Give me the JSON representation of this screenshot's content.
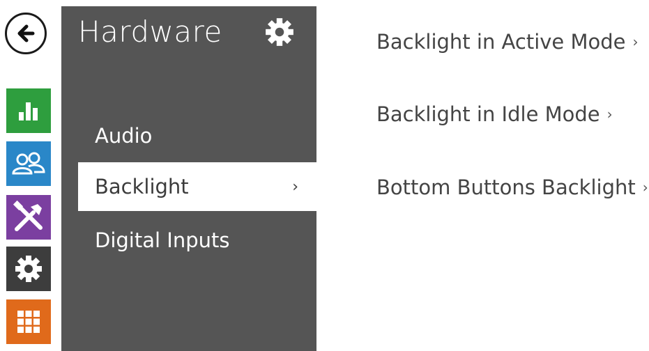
{
  "nav": {
    "back_icon": "arrow-left-icon",
    "tiles": [
      {
        "name": "status",
        "icon": "bar-chart-icon",
        "color": "#2e9e3e"
      },
      {
        "name": "directory",
        "icon": "users-icon",
        "color": "#2a87c8"
      },
      {
        "name": "services",
        "icon": "tools-icon",
        "color": "#7b3fa0"
      },
      {
        "name": "hardware",
        "icon": "gear-icon",
        "color": "#3d3d3d"
      },
      {
        "name": "system",
        "icon": "grid-icon",
        "color": "#e06a1b"
      }
    ]
  },
  "panel": {
    "title": "Hardware",
    "title_icon": "gear-icon",
    "background": "#555555",
    "items": [
      {
        "label": "Audio",
        "active": false
      },
      {
        "label": "Backlight",
        "active": true,
        "chevron": "›"
      },
      {
        "label": "Digital Inputs",
        "active": false
      }
    ]
  },
  "content": {
    "items": [
      {
        "label": "Backlight in Active Mode",
        "chevron": "›"
      },
      {
        "label": "Backlight in Idle Mode",
        "chevron": "›"
      },
      {
        "label": "Bottom Buttons Backlight",
        "chevron": "›"
      }
    ]
  }
}
